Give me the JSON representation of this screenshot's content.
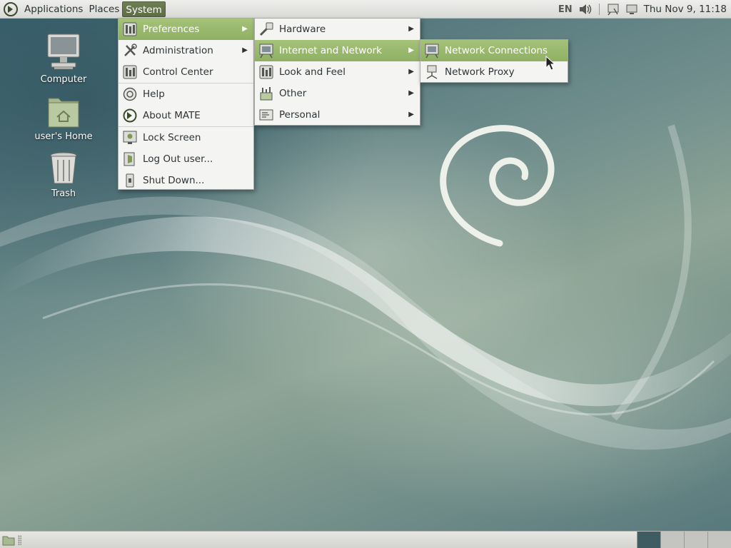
{
  "top_panel": {
    "menus": [
      "Applications",
      "Places",
      "System"
    ],
    "active_menu": "System",
    "keyboard_layout": "EN",
    "clock": "Thu Nov  9, 11:18"
  },
  "desktop_icons": [
    {
      "label": "Computer",
      "icon": "computer-icon"
    },
    {
      "label": "user's Home",
      "icon": "home-folder-icon"
    },
    {
      "label": "Trash",
      "icon": "trash-icon"
    }
  ],
  "system_menu": {
    "items": [
      {
        "label": "Preferences",
        "icon": "preferences-icon",
        "submenu": true,
        "highlighted": true
      },
      {
        "label": "Administration",
        "icon": "administration-icon",
        "submenu": true
      },
      {
        "label": "Control Center",
        "icon": "control-center-icon"
      },
      {
        "label": "Help",
        "icon": "help-icon"
      },
      {
        "label": "About MATE",
        "icon": "mate-logo-icon"
      },
      {
        "label": "Lock Screen",
        "icon": "lock-screen-icon"
      },
      {
        "label": "Log Out user...",
        "icon": "log-out-icon"
      },
      {
        "label": "Shut Down...",
        "icon": "shut-down-icon"
      }
    ]
  },
  "preferences_menu": {
    "items": [
      {
        "label": "Hardware",
        "icon": "hardware-icon",
        "submenu": true
      },
      {
        "label": "Internet and Network",
        "icon": "network-icon",
        "submenu": true,
        "highlighted": true
      },
      {
        "label": "Look and Feel",
        "icon": "look-and-feel-icon",
        "submenu": true
      },
      {
        "label": "Other",
        "icon": "other-icon",
        "submenu": true
      },
      {
        "label": "Personal",
        "icon": "personal-icon",
        "submenu": true
      }
    ]
  },
  "network_menu": {
    "items": [
      {
        "label": "Network Connections",
        "icon": "network-connections-icon",
        "highlighted": true
      },
      {
        "label": "Network Proxy",
        "icon": "network-proxy-icon"
      }
    ]
  },
  "colors": {
    "menu_highlight": "#9cbb6e",
    "panel_active": "#5d6e46",
    "menu_background": "#f4f4f2"
  }
}
